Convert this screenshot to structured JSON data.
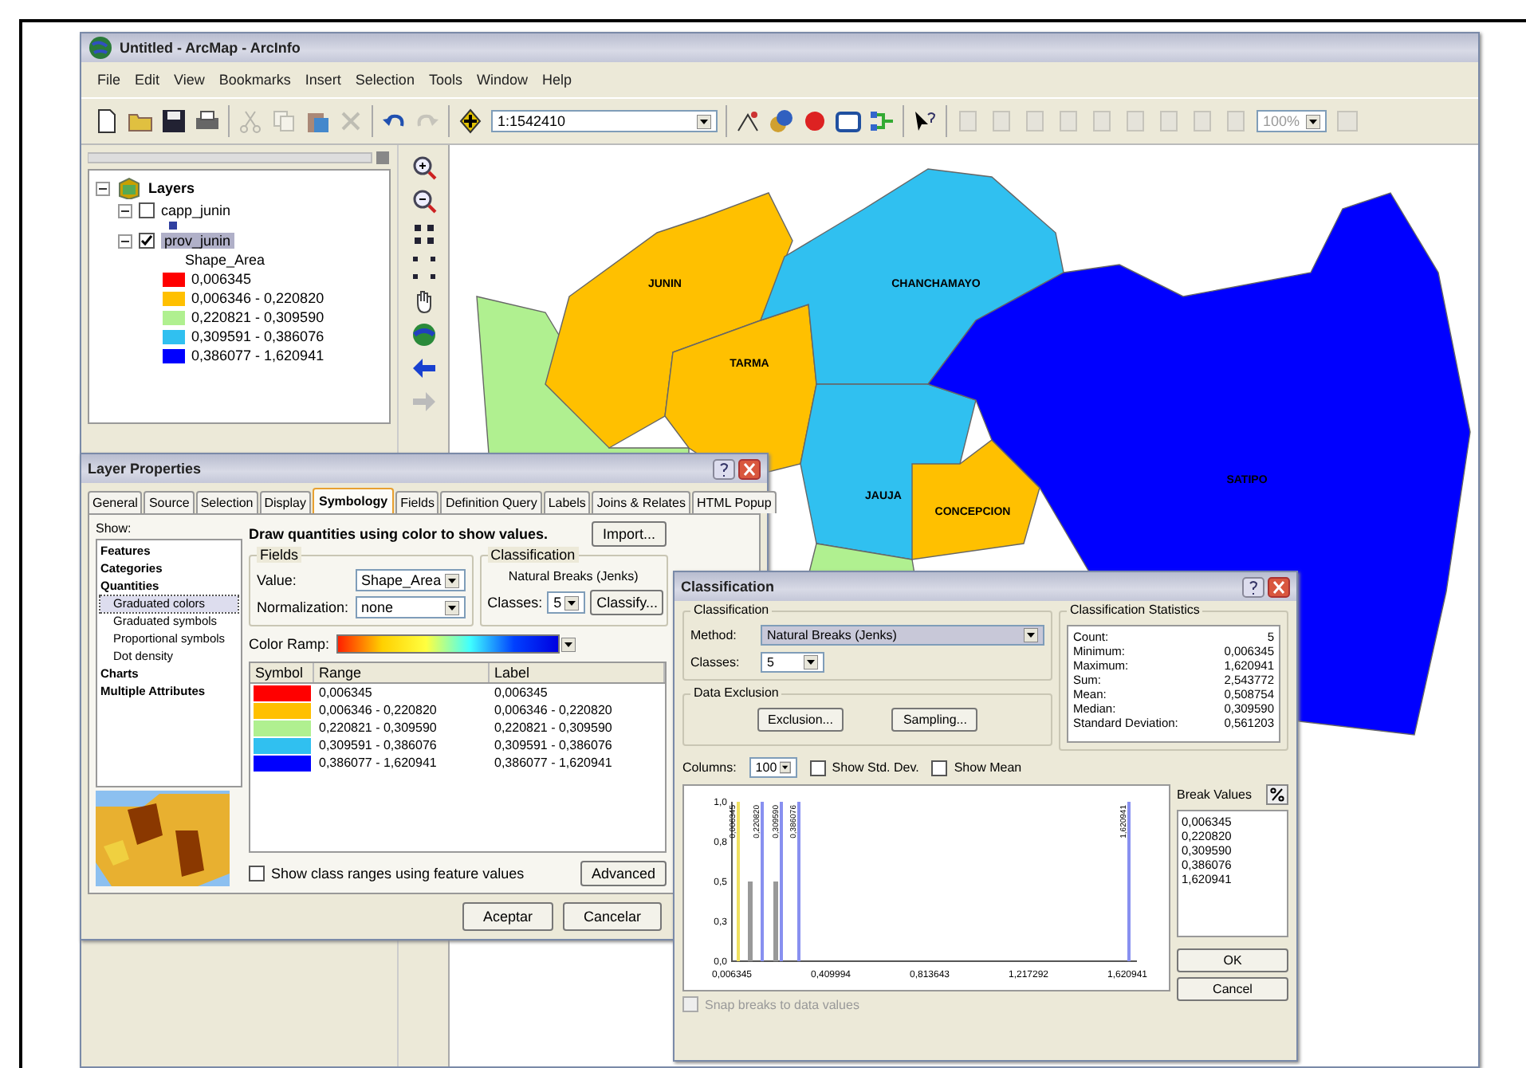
{
  "arcmap": {
    "title": "Untitled - ArcMap - ArcInfo",
    "menu": [
      "File",
      "Edit",
      "View",
      "Bookmarks",
      "Insert",
      "Selection",
      "Tools",
      "Window",
      "Help"
    ],
    "scale": "1:1542410",
    "layout_zoom": "100%",
    "toc": {
      "root": "Layers",
      "expanded": true,
      "layers": [
        {
          "name": "capp_junin",
          "checked": false,
          "expanded": true,
          "selected": false,
          "classes": [
            {
              "color": "#3040a0"
            }
          ]
        },
        {
          "name": "prov_junin",
          "checked": true,
          "expanded": true,
          "selected": true,
          "field": "Shape_Area",
          "classes": [
            {
              "label": "0,006345",
              "color": "#ff0000"
            },
            {
              "label": "0,006346 - 0,220820",
              "color": "#ffc000"
            },
            {
              "label": "0,220821 - 0,309590",
              "color": "#b0f090"
            },
            {
              "label": "0,309591 - 0,386076",
              "color": "#30c0f0"
            },
            {
              "label": "0,386077 - 1,620941",
              "color": "#0000ff"
            }
          ]
        }
      ]
    },
    "map": {
      "regions": [
        {
          "color": "#b0f090"
        },
        {
          "label": "JUNIN",
          "color": "#ffc000"
        },
        {
          "label": "TARMA",
          "color": "#ffc000"
        },
        {
          "label": "CHANCHAMAYO",
          "color": "#30c0f0"
        },
        {
          "label": "JAUJA",
          "color": "#30c0f0"
        },
        {
          "color": "#b0f090"
        },
        {
          "label": "CONCEPCION",
          "color": "#ffc000"
        },
        {
          "label": "SATIPO",
          "color": "#0000ff"
        }
      ]
    }
  },
  "layer_properties": {
    "title": "Layer Properties",
    "tabs": [
      {
        "label": "General",
        "selected": false
      },
      {
        "label": "Source",
        "selected": false
      },
      {
        "label": "Selection",
        "selected": false
      },
      {
        "label": "Display",
        "selected": false
      },
      {
        "label": "Symbology",
        "selected": true
      },
      {
        "label": "Fields",
        "selected": false
      },
      {
        "label": "Definition Query",
        "selected": false
      },
      {
        "label": "Labels",
        "selected": false
      },
      {
        "label": "Joins & Relates",
        "selected": false
      },
      {
        "label": "HTML Popup",
        "selected": false
      }
    ],
    "show_label": "Show:",
    "show_items": [
      {
        "label": "Features",
        "selected": false
      },
      {
        "label": "Categories",
        "selected": false
      },
      {
        "label": "Quantities",
        "selected": false,
        "children": [
          {
            "label": "Graduated colors",
            "selected": true
          },
          {
            "label": "Graduated symbols",
            "selected": false
          },
          {
            "label": "Proportional symbols",
            "selected": false
          },
          {
            "label": "Dot density",
            "selected": false
          }
        ]
      },
      {
        "label": "Charts",
        "selected": false
      },
      {
        "label": "Multiple Attributes",
        "selected": false
      }
    ],
    "description": "Draw quantities using color to show values.",
    "import_button": "Import...",
    "fields_group": "Fields",
    "value_label": "Value:",
    "value": "Shape_Area",
    "normalization_label": "Normalization:",
    "normalization": "none",
    "classification_group": "Classification",
    "method": "Natural Breaks (Jenks)",
    "classes_label": "Classes:",
    "classes": "5",
    "classify_button": "Classify...",
    "color_ramp_label": "Color Ramp:",
    "columns": [
      "Symbol",
      "Range",
      "Label"
    ],
    "rows": [
      {
        "color": "#ff0000",
        "range": "0,006345",
        "label": "0,006345"
      },
      {
        "color": "#ffc000",
        "range": "0,006346 - 0,220820",
        "label": "0,006346 - 0,220820"
      },
      {
        "color": "#b0f090",
        "range": "0,220821 - 0,309590",
        "label": "0,220821 - 0,309590"
      },
      {
        "color": "#30c0f0",
        "range": "0,309591 - 0,386076",
        "label": "0,309591 - 0,386076"
      },
      {
        "color": "#0000ff",
        "range": "0,386077 - 1,620941",
        "label": "0,386077 - 1,620941"
      }
    ],
    "feature_values": {
      "label": "Show class ranges using feature values",
      "checked": false
    },
    "advanced_button": "Advanced",
    "buttons": [
      "Aceptar",
      "Cancelar"
    ]
  },
  "classification": {
    "title": "Classification",
    "group": "Classification",
    "method_label": "Method:",
    "method": "Natural Breaks (Jenks)",
    "classes_label": "Classes:",
    "classes": "5",
    "exclusion_group": "Data Exclusion",
    "exclusion_button": "Exclusion...",
    "sampling_button": "Sampling...",
    "statistics_group": "Classification Statistics",
    "statistics": [
      {
        "name": "Count:",
        "value": "5"
      },
      {
        "name": "Minimum:",
        "value": "0,006345"
      },
      {
        "name": "Maximum:",
        "value": "1,620941"
      },
      {
        "name": "Sum:",
        "value": "2,543772"
      },
      {
        "name": "Mean:",
        "value": "0,508754"
      },
      {
        "name": "Median:",
        "value": "0,309590"
      },
      {
        "name": "Standard Deviation:",
        "value": "0,561203"
      }
    ],
    "columns_label": "Columns:",
    "columns": "100",
    "options": [
      {
        "label": "Show Std. Dev.",
        "checked": false
      },
      {
        "label": "Show Mean",
        "checked": false
      }
    ],
    "histogram": {
      "break_labels": [
        "0,006345",
        "0,220820",
        "0,309590",
        "0,386076",
        "1,620941"
      ],
      "y_tick_labels": [
        "1,0",
        "0,8",
        "0,5",
        "0,3",
        "0,0"
      ],
      "x_tick_labels": [
        "0,006345",
        "0,409994",
        "0,813643",
        "1,217292",
        "1,620941"
      ]
    },
    "break_values_label": "Break Values",
    "break_values": [
      {
        "value": "0,006345",
        "selected": false
      },
      {
        "value": "0,220820",
        "selected": false
      },
      {
        "value": "0,309590",
        "selected": false
      },
      {
        "value": "0,386076",
        "selected": false
      },
      {
        "value": "1,620941",
        "selected": false
      }
    ],
    "snap": {
      "label": "Snap breaks to data values",
      "checked": false,
      "disabled": true
    },
    "buttons": [
      "OK",
      "Cancel"
    ]
  }
}
